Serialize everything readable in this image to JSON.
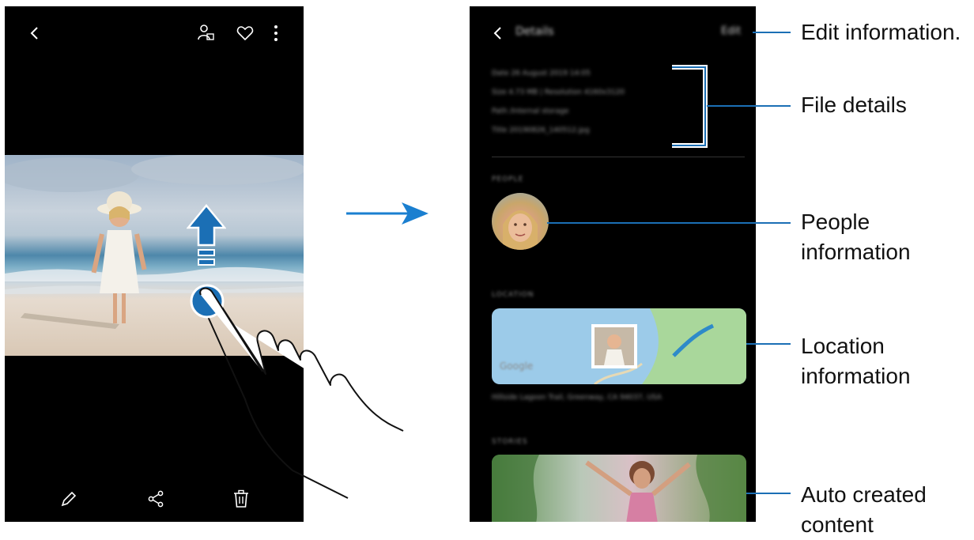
{
  "right_phone": {
    "header": {
      "title": "Details",
      "edit_label": "Edit"
    },
    "file_details": {
      "date": "Date   26 August 2019 14:05",
      "size": "Size   4.73 MB     |     Resolution   4160x3120",
      "path": "Path   /Internal storage",
      "title": "Title  20190826_140512.jpg"
    },
    "sections": {
      "people": "PEOPLE",
      "location": "LOCATION",
      "stories": "STORIES"
    },
    "location_address": "Hillside Lagoon Trail, Greenway, CA 94037, USA",
    "map_brand": "Google"
  },
  "callouts": {
    "edit": "Edit information.",
    "file": "File details",
    "people": [
      "People",
      "information"
    ],
    "location": [
      "Location",
      "information"
    ],
    "auto": [
      "Auto created",
      "content"
    ]
  },
  "colors": {
    "accent": "#1b6fb5",
    "arrow": "#1a7fd0"
  }
}
